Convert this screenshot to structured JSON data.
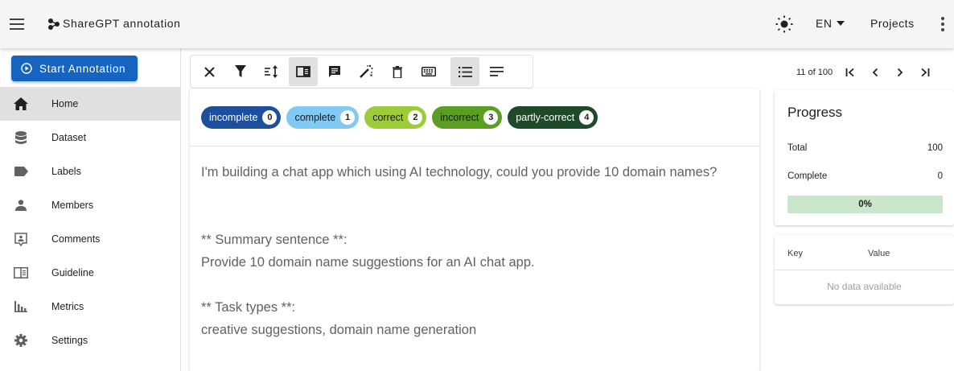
{
  "appbar": {
    "title": "ShareGPT annotation",
    "language": "EN",
    "projects_label": "Projects"
  },
  "sidebar": {
    "start_button": "Start Annotation",
    "items": [
      {
        "label": "Home",
        "icon": "home-icon",
        "active": true
      },
      {
        "label": "Dataset",
        "icon": "database-icon"
      },
      {
        "label": "Labels",
        "icon": "label-icon"
      },
      {
        "label": "Members",
        "icon": "person-icon"
      },
      {
        "label": "Comments",
        "icon": "comment-account-icon"
      },
      {
        "label": "Guideline",
        "icon": "book-open-icon"
      },
      {
        "label": "Metrics",
        "icon": "bar-chart-icon"
      },
      {
        "label": "Settings",
        "icon": "gear-icon"
      }
    ]
  },
  "toolbar": {
    "buttons": [
      "close-icon",
      "filter-icon",
      "sort-icon",
      "book-icon",
      "comment-icon",
      "auto-fix-icon",
      "delete-icon",
      "keyboard-icon",
      "list-view-icon",
      "text-view-icon"
    ]
  },
  "pager": {
    "text": "11 of 100"
  },
  "labels": [
    {
      "name": "incomplete",
      "key": "0",
      "bg": "#1e4f9c",
      "fg": "#ffffff"
    },
    {
      "name": "complete",
      "key": "1",
      "bg": "#81c9f2",
      "fg": "#1a1a1a"
    },
    {
      "name": "correct",
      "key": "2",
      "bg": "#9ccc3a",
      "fg": "#1a1a1a"
    },
    {
      "name": "incorrect",
      "key": "3",
      "bg": "#5a9e24",
      "fg": "#1a1a1a"
    },
    {
      "name": "partly-correct",
      "key": "4",
      "bg": "#1f4a2a",
      "fg": "#ffffff"
    }
  ],
  "document": {
    "question": "I'm building a chat app which using AI technology, could you provide 10 domain names?",
    "summary_heading": "** Summary sentence **:",
    "summary_text": "Provide 10 domain name suggestions for an AI chat app.",
    "task_heading": "** Task types **:",
    "task_text": "creative suggestions, domain name generation"
  },
  "progress": {
    "title": "Progress",
    "total_label": "Total",
    "total_value": "100",
    "complete_label": "Complete",
    "complete_value": "0",
    "percent": "0%"
  },
  "metadata": {
    "key_header": "Key",
    "value_header": "Value",
    "empty_text": "No data available"
  },
  "colors": {
    "primary": "#1565c0",
    "progress_bar": "#c8e6c9"
  }
}
